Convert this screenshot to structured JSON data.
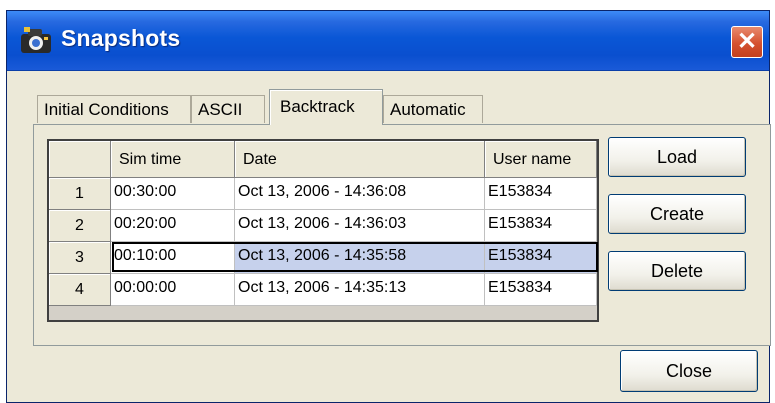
{
  "window": {
    "title": "Snapshots",
    "close_glyph": "✕"
  },
  "tabs": [
    {
      "label": "Initial Conditions",
      "active": false
    },
    {
      "label": "ASCII",
      "active": false
    },
    {
      "label": "Backtrack",
      "active": true
    },
    {
      "label": "Automatic",
      "active": false
    }
  ],
  "table": {
    "columns": [
      "Sim time",
      "Date",
      "User name"
    ],
    "rows": [
      {
        "num": "1",
        "sim_time": "00:30:00",
        "date": "Oct 13, 2006 - 14:36:08",
        "user": "E153834",
        "selected": false
      },
      {
        "num": "2",
        "sim_time": "00:20:00",
        "date": "Oct 13, 2006 - 14:36:03",
        "user": "E153834",
        "selected": false
      },
      {
        "num": "3",
        "sim_time": "00:10:00",
        "date": "Oct 13, 2006 - 14:35:58",
        "user": "E153834",
        "selected": true
      },
      {
        "num": "4",
        "sim_time": "00:00:00",
        "date": "Oct 13, 2006 - 14:35:13",
        "user": "E153834",
        "selected": false
      }
    ]
  },
  "buttons": {
    "load": "Load",
    "create": "Create",
    "delete": "Delete",
    "close": "Close"
  },
  "colors": {
    "titlebar": "#0a57d6",
    "selection": "#c6d1ec",
    "dialog_bg": "#ece9d8"
  },
  "icons": {
    "app": "camera-icon",
    "close": "close-icon"
  }
}
